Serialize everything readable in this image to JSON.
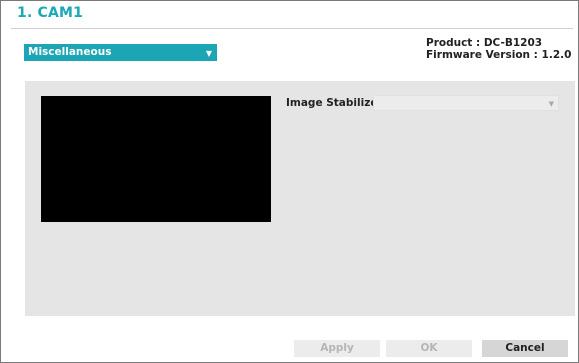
{
  "dialog": {
    "title": "1. CAM1"
  },
  "category": {
    "selected": "Miscellaneous",
    "chevron_icon": "chevron-down-icon"
  },
  "device_info": {
    "product": "Product : DC-B1203",
    "firmware": "Firmware Version : 1.2.0"
  },
  "settings": {
    "image_stabilizer_label": "Image Stabilizer",
    "image_stabilizer_value": ""
  },
  "buttons": {
    "apply": "Apply",
    "ok": "OK",
    "cancel": "Cancel"
  },
  "colors": {
    "accent": "#19a9b7",
    "preview_background": "#000000",
    "panel_background": "#e5e5e5"
  }
}
